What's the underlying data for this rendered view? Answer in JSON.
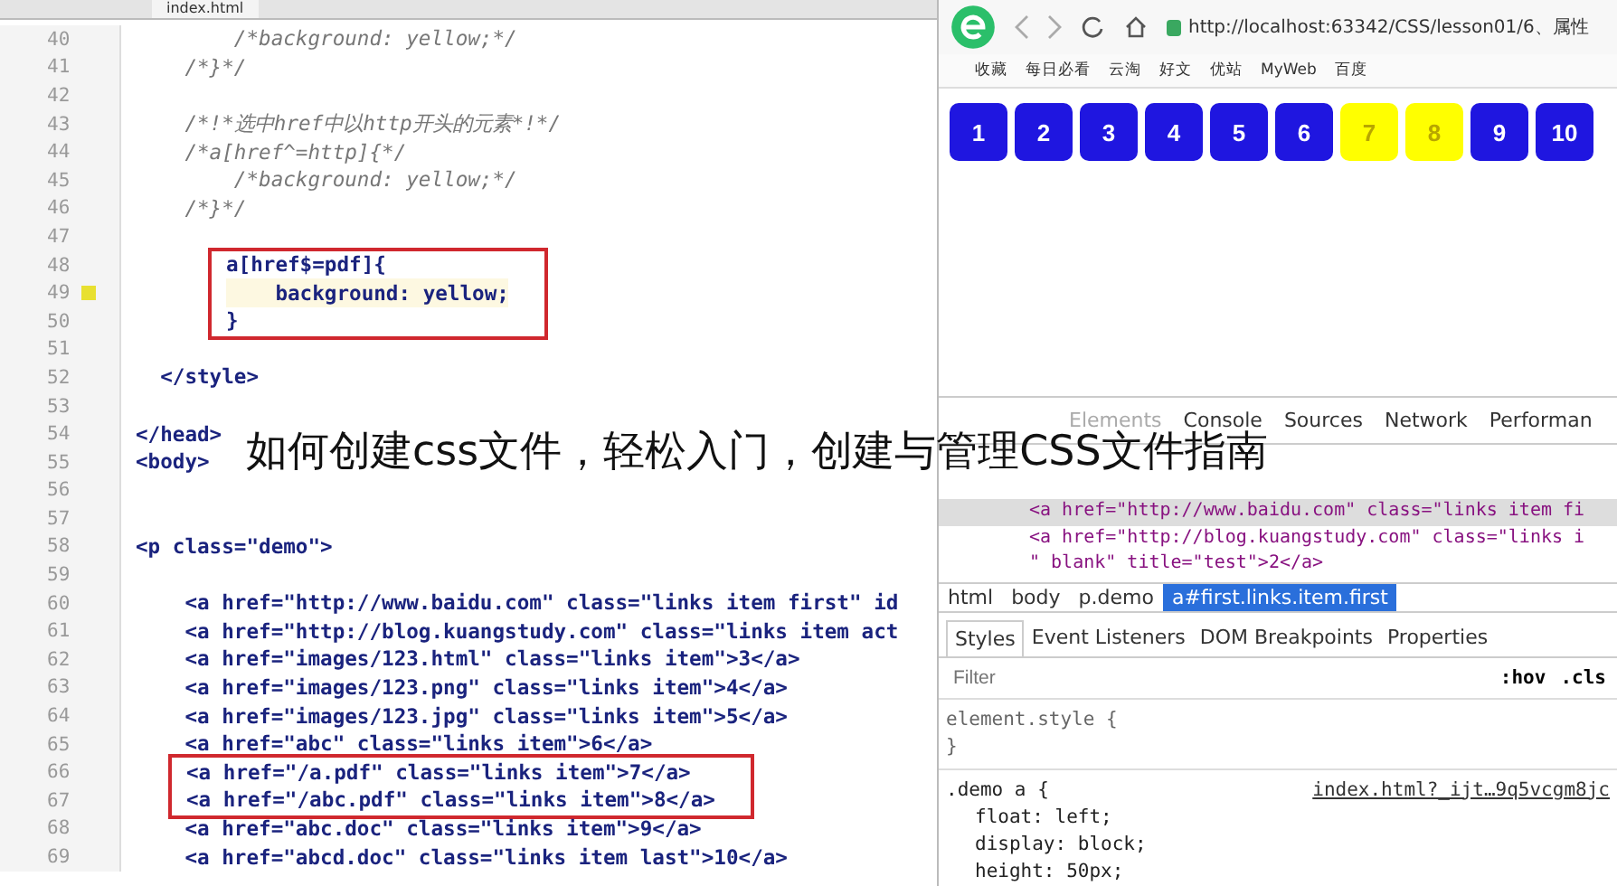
{
  "editor": {
    "tab": "index.html",
    "sections": [
      {
        "boxed": false,
        "lines": [
          {
            "number": "40",
            "text": "        /*background: yellow;*/",
            "kind": "comment",
            "current": false
          },
          {
            "number": "41",
            "text": "    /*}*/",
            "kind": "comment",
            "current": false
          },
          {
            "number": "42",
            "kind": "blank",
            "current": false
          },
          {
            "number": "43",
            "text": "    /*!*选中href中以http开头的元素*!*/",
            "kind": "comment",
            "current": false
          },
          {
            "number": "44",
            "text": "    /*a[href^=http]{*/",
            "kind": "comment",
            "current": false
          },
          {
            "number": "45",
            "text": "        /*background: yellow;*/",
            "kind": "comment",
            "current": false
          },
          {
            "number": "46",
            "text": "    /*}*/",
            "kind": "comment",
            "current": false
          },
          {
            "number": "47",
            "kind": "blank",
            "current": false
          }
        ]
      },
      {
        "boxed": true,
        "lines": [
          {
            "number": "48",
            "text": "a[href$=pdf]{",
            "kind": "code",
            "current": false
          },
          {
            "number": "49",
            "text": "    background: yellow;",
            "kind": "code",
            "current": true
          },
          {
            "number": "50",
            "text": "}",
            "kind": "code",
            "current": false
          }
        ]
      },
      {
        "boxed": false,
        "lines": [
          {
            "number": "51",
            "kind": "blank",
            "current": false
          },
          {
            "number": "52",
            "text": "  </style>",
            "kind": "code",
            "current": false
          },
          {
            "number": "53",
            "kind": "blank",
            "current": false
          },
          {
            "number": "54",
            "text": "</head>",
            "kind": "code",
            "current": false
          },
          {
            "number": "55",
            "text": "<body>",
            "kind": "code",
            "current": false
          },
          {
            "number": "56",
            "kind": "blank",
            "current": false
          },
          {
            "number": "57",
            "kind": "blank",
            "current": false
          },
          {
            "number": "58",
            "text": "<p class=\"demo\">",
            "kind": "code",
            "current": false
          },
          {
            "number": "59",
            "kind": "blank",
            "current": false
          },
          {
            "number": "60",
            "text": "    <a href=\"http://www.baidu.com\" class=\"links item first\" id",
            "kind": "code",
            "current": false
          },
          {
            "number": "61",
            "text": "    <a href=\"http://blog.kuangstudy.com\" class=\"links item act",
            "kind": "code",
            "current": false
          },
          {
            "number": "62",
            "text": "    <a href=\"images/123.html\" class=\"links item\">3</a>",
            "kind": "code",
            "current": false
          },
          {
            "number": "63",
            "text": "    <a href=\"images/123.png\" class=\"links item\">4</a>",
            "kind": "code",
            "current": false
          },
          {
            "number": "64",
            "text": "    <a href=\"images/123.jpg\" class=\"links item\">5</a>",
            "kind": "code",
            "current": false
          },
          {
            "number": "65",
            "text": "    <a href=\"abc\" class=\"links item\">6</a>",
            "kind": "code",
            "current": false
          }
        ]
      },
      {
        "boxed": true,
        "lines": [
          {
            "number": "66",
            "text": "<a href=\"/a.pdf\" class=\"links item\">7</a>",
            "kind": "code",
            "current": false
          },
          {
            "number": "67",
            "text": "<a href=\"/abc.pdf\" class=\"links item\">8</a>",
            "kind": "code",
            "current": false
          }
        ]
      },
      {
        "boxed": false,
        "lines": [
          {
            "number": "68",
            "text": "    <a href=\"abc.doc\" class=\"links item\">9</a>",
            "kind": "code",
            "current": false
          },
          {
            "number": "69",
            "text": "    <a href=\"abcd.doc\" class=\"links item last\">10</a>",
            "kind": "code",
            "current": false
          }
        ]
      }
    ]
  },
  "browser": {
    "address": "http://localhost:63342/CSS/lesson01/6、属性",
    "bookmarks": [
      "收藏",
      "每日必看",
      "云淘",
      "好文",
      "优站",
      "MyWeb",
      "百度"
    ],
    "boxes": [
      {
        "label": "1",
        "highlighted": false
      },
      {
        "label": "2",
        "highlighted": false
      },
      {
        "label": "3",
        "highlighted": false
      },
      {
        "label": "4",
        "highlighted": false
      },
      {
        "label": "5",
        "highlighted": false
      },
      {
        "label": "6",
        "highlighted": false
      },
      {
        "label": "7",
        "highlighted": true
      },
      {
        "label": "8",
        "highlighted": true
      },
      {
        "label": "9",
        "highlighted": false
      },
      {
        "label": "10",
        "highlighted": false
      }
    ]
  },
  "devtools": {
    "tabs": [
      {
        "label": "Elements",
        "selected": true
      },
      {
        "label": "Console",
        "selected": false
      },
      {
        "label": "Sources",
        "selected": false
      },
      {
        "label": "Network",
        "selected": false
      },
      {
        "label": "Performan",
        "selected": false
      }
    ],
    "tree": [
      {
        "text": "<a href=\"http://www.baidu.com\" class=\"links item fi",
        "selected": true
      },
      {
        "text": "<a href=\"http://blog.kuangstudy.com\" class=\"links i",
        "selected": false
      },
      {
        "text": "\" blank\" title=\"test\">2</a>",
        "selected": false
      }
    ],
    "breadcrumbs": [
      {
        "label": "html",
        "selected": false
      },
      {
        "label": "body",
        "selected": false
      },
      {
        "label": "p.demo",
        "selected": false
      },
      {
        "label": "a#first.links.item.first",
        "selected": true
      }
    ],
    "panel_tabs": [
      {
        "label": "Styles",
        "selected": true
      },
      {
        "label": "Event Listeners",
        "selected": false
      },
      {
        "label": "DOM Breakpoints",
        "selected": false
      },
      {
        "label": "Properties",
        "selected": false
      }
    ],
    "filter": {
      "placeholder": "Filter",
      "hov": ":hov",
      "cls": ".cls"
    },
    "element_style": [
      "element.style {",
      "}"
    ],
    "rule": {
      "selector": ".demo a {",
      "source": "index.html?_ijt…9q5vcgm8jc",
      "declarations": [
        "float: left;",
        "display: block;",
        "height: 50px;"
      ]
    }
  },
  "caption": "如何创建css文件，轻松入门，创建与管理CSS文件指南"
}
